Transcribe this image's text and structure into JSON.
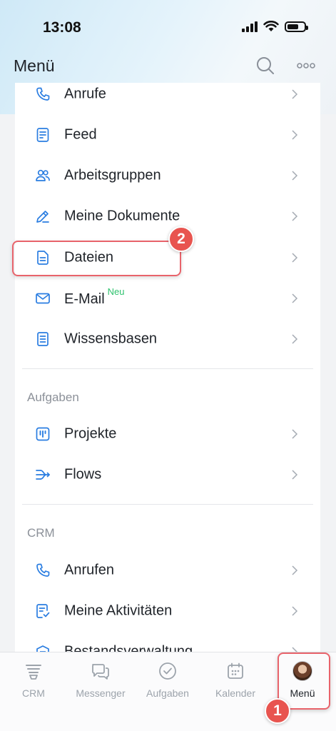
{
  "status": {
    "time": "13:08"
  },
  "header": {
    "title": "Menü"
  },
  "items_main": [
    {
      "label": "Anrufe",
      "icon": "phone-icon"
    },
    {
      "label": "Feed",
      "icon": "feed-icon"
    },
    {
      "label": "Arbeitsgruppen",
      "icon": "groups-icon"
    },
    {
      "label": "Meine Dokumente",
      "icon": "pen-icon"
    },
    {
      "label": "Dateien",
      "icon": "file-icon"
    },
    {
      "label": "E-Mail",
      "icon": "mail-icon",
      "badge": "Neu"
    },
    {
      "label": "Wissensbasen",
      "icon": "book-icon"
    }
  ],
  "section_tasks": {
    "title": "Aufgaben",
    "items": [
      {
        "label": "Projekte",
        "icon": "project-icon"
      },
      {
        "label": "Flows",
        "icon": "flows-icon"
      }
    ]
  },
  "section_crm": {
    "title": "CRM",
    "items": [
      {
        "label": "Anrufen",
        "icon": "phone-icon"
      },
      {
        "label": "Meine Aktivitäten",
        "icon": "activities-icon"
      },
      {
        "label": "Bestandsverwaltung",
        "icon": "inventory-icon"
      }
    ]
  },
  "annotations": {
    "step1": "1",
    "step2": "2"
  },
  "tabbar": {
    "tabs": [
      {
        "label": "CRM",
        "icon": "crm-icon"
      },
      {
        "label": "Messenger",
        "icon": "messenger-icon"
      },
      {
        "label": "Aufgaben",
        "icon": "tasks-check-icon"
      },
      {
        "label": "Kalender",
        "icon": "calendar-icon"
      },
      {
        "label": "Menü",
        "icon": "avatar",
        "active": true
      }
    ]
  },
  "colors": {
    "accent_blue": "#2a7de1",
    "highlight_red": "#e8636b",
    "badge_red": "#e8544f",
    "new_green": "#2fc26e"
  }
}
